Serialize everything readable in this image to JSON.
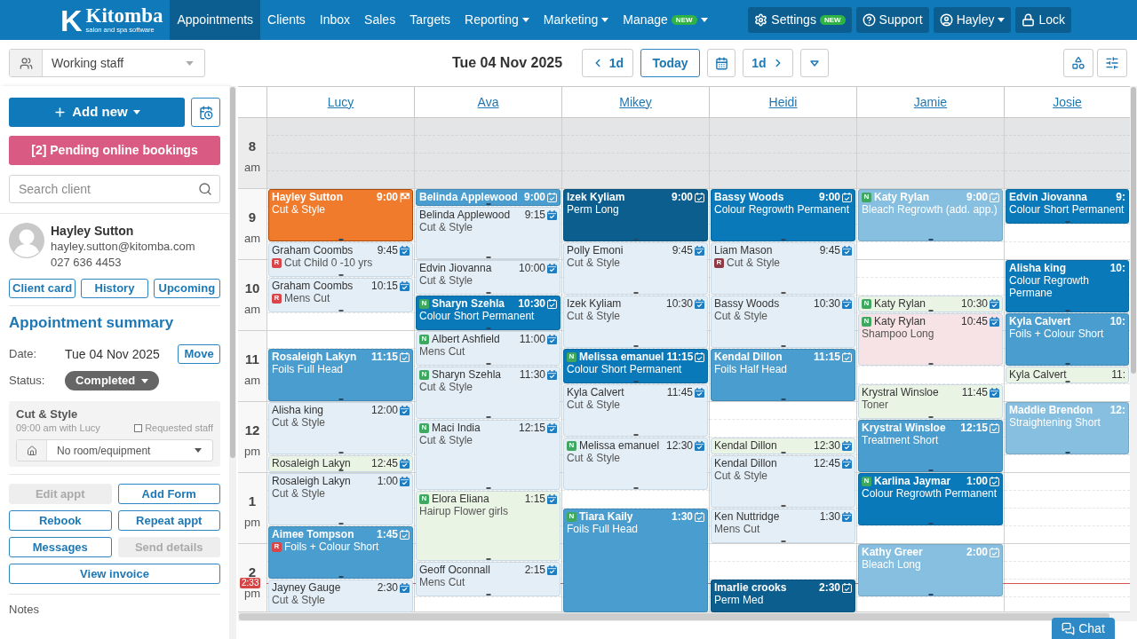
{
  "nav": {
    "logo": {
      "mark": "K",
      "name": "Kitomba",
      "tagline": "salon and spa software"
    },
    "items": [
      {
        "label": "Appointments",
        "selected": true,
        "dropdown": false
      },
      {
        "label": "Clients",
        "selected": false,
        "dropdown": false
      },
      {
        "label": "Inbox",
        "selected": false,
        "dropdown": false
      },
      {
        "label": "Sales",
        "selected": false,
        "dropdown": false
      },
      {
        "label": "Targets",
        "selected": false,
        "dropdown": false
      },
      {
        "label": "Reporting",
        "selected": false,
        "dropdown": true
      },
      {
        "label": "Marketing",
        "selected": false,
        "dropdown": true
      },
      {
        "label": "Manage",
        "selected": false,
        "dropdown": true,
        "badge": "NEW"
      }
    ],
    "actions": [
      {
        "kind": "settings",
        "label": "Settings",
        "badge": "NEW",
        "dropdown": false
      },
      {
        "kind": "support",
        "label": "Support",
        "dropdown": false
      },
      {
        "kind": "user",
        "label": "Hayley",
        "dropdown": true
      },
      {
        "kind": "lock",
        "label": "Lock",
        "dropdown": false
      }
    ]
  },
  "toolbar": {
    "staff_filter": "Working staff",
    "date": "Tue 04 Nov 2025",
    "prev_day": "1d",
    "today": "Today",
    "next_day": "1d"
  },
  "sidebar": {
    "add_new": "Add new",
    "pending": "[2] Pending online bookings",
    "search": {
      "placeholder": "Search client"
    },
    "client": {
      "name": "Hayley Sutton",
      "email": "hayley.sutton@kitomba.com",
      "phone": "027 636 4453"
    },
    "client_buttons": [
      {
        "label": "Client card"
      },
      {
        "label": "History"
      },
      {
        "label": "Upcoming"
      }
    ],
    "summary": {
      "title": "Appointment summary",
      "date_label": "Date:",
      "date": "Tue 04 Nov 2025",
      "move": "Move",
      "status_label": "Status:",
      "status": "Completed"
    },
    "service": {
      "name": "Cut & Style",
      "detail": "09:00 am with Lucy",
      "requested_staff": {
        "label": "Requested staff",
        "checked": false
      },
      "room": {
        "value": "No room/equipment"
      }
    },
    "actions": [
      {
        "label": "Edit appt",
        "disabled": true,
        "wide": false
      },
      {
        "label": "Add Form",
        "disabled": false,
        "wide": false
      },
      {
        "label": "Rebook",
        "disabled": false,
        "wide": false
      },
      {
        "label": "Repeat appt",
        "disabled": false,
        "wide": false
      },
      {
        "label": "Messages",
        "disabled": false,
        "wide": false
      },
      {
        "label": "Send details",
        "disabled": true,
        "wide": false
      },
      {
        "label": "View invoice",
        "disabled": false,
        "wide": true
      }
    ],
    "notes_title": "Notes"
  },
  "calendar": {
    "hours": [
      {
        "hour": "8",
        "period": "am",
        "closed": true
      },
      {
        "hour": "9",
        "period": "am",
        "closed": false
      },
      {
        "hour": "10",
        "period": "am",
        "closed": false
      },
      {
        "hour": "11",
        "period": "am",
        "closed": false
      },
      {
        "hour": "12",
        "period": "pm",
        "closed": false
      },
      {
        "hour": "1",
        "period": "pm",
        "closed": false
      },
      {
        "hour": "2",
        "period": "pm",
        "closed": false,
        "now": "2:33"
      }
    ],
    "staff": [
      {
        "name": "Lucy",
        "entries": [
          {
            "kind": "threequarter",
            "client": "Hayley Sutton",
            "time": "9:00",
            "service": "Cut & Style",
            "color": "#f07b2c",
            "selected": true,
            "completed": true
          },
          {
            "kind": "half",
            "client": "Graham Coombs",
            "time": "9:45",
            "service": "Cut Child 0 -10 yrs",
            "service_tag": {
              "label": "R",
              "color": "#d9464a"
            },
            "color": "#e3eef7",
            "selected": false,
            "completed": false
          },
          {
            "kind": "half",
            "client": "Graham Coombs",
            "time": "10:15",
            "service": "Mens Cut",
            "service_tag": {
              "label": "R",
              "color": "#d9464a"
            },
            "color": "#e3eef7",
            "selected": false,
            "completed": false
          },
          {
            "kind": "gaphalf"
          },
          {
            "kind": "threequarter",
            "client": "Rosaleigh Lakyn",
            "time": "11:15",
            "service": "Foils Full Head",
            "color": "#4a9dcf",
            "selected": false,
            "completed": false
          },
          {
            "kind": "threequarter",
            "client": "Alisha king",
            "time": "12:00",
            "service": "Cut & Style",
            "color": "#e3eef7",
            "selected": false,
            "completed": false
          },
          {
            "kind": "quarter",
            "client": "Rosaleigh Lakyn",
            "time": "12:45",
            "color": "#eaf4e5",
            "selected": false,
            "completed": false
          },
          {
            "kind": "threequarter",
            "client": "Rosaleigh Lakyn",
            "time": "1:00",
            "service": "Cut & Style",
            "color": "#e3eef7",
            "selected": false,
            "completed": false
          },
          {
            "kind": "threequarter",
            "client": "Aimee Tompson",
            "time": "1:45",
            "service": "Foils + Colour Short",
            "service_tag": {
              "label": "R",
              "color": "#d9464a"
            },
            "color": "#4a9dcf",
            "selected": false,
            "completed": false
          },
          {
            "kind": "threequarter",
            "client": "Jayney Gauge",
            "time": "2:30",
            "service": "Cut & Style",
            "color": "#e3eef7",
            "selected": false,
            "completed": false
          }
        ]
      },
      {
        "name": "Ava",
        "entries": [
          {
            "kind": "quarter",
            "client": "Belinda Applewood",
            "time": "9:00",
            "color": "#4a9dcf",
            "selected": false,
            "completed": false
          },
          {
            "kind": "threequarter",
            "client": "Belinda Applewood",
            "time": "9:15",
            "service": "Cut & Style",
            "color": "#e3eef7",
            "selected": false,
            "completed": false
          },
          {
            "kind": "half",
            "client": "Edvin Jiovanna",
            "time": "10:00",
            "service": "Cut & Style",
            "color": "#e3eef7",
            "selected": false,
            "completed": false
          },
          {
            "kind": "half",
            "client": "Sharyn Szehla",
            "time": "10:30",
            "service": "Colour Short Permanent",
            "name_tag": {
              "label": "N",
              "color": "#3ea860"
            },
            "color": "#0a79b9",
            "selected": false,
            "completed": false
          },
          {
            "kind": "half",
            "client": "Albert Ashfield",
            "time": "11:00",
            "service": "Mens Cut",
            "name_tag": {
              "label": "N",
              "color": "#3ea860"
            },
            "color": "#e3eef7",
            "selected": false,
            "completed": false
          },
          {
            "kind": "threequarter",
            "client": "Sharyn Szehla",
            "time": "11:30",
            "service": "Cut & Style",
            "name_tag": {
              "label": "N",
              "color": "#3ea860"
            },
            "color": "#e3eef7",
            "selected": false,
            "completed": false
          },
          {
            "kind": "hour",
            "client": "Maci India",
            "time": "12:15",
            "service": "Cut & Style",
            "name_tag": {
              "label": "N",
              "color": "#3ea860"
            },
            "color": "#e3eef7",
            "selected": false,
            "completed": false
          },
          {
            "kind": "hour",
            "client": "Elora Eliana",
            "time": "1:15",
            "service": "Hairup Flower girls",
            "name_tag": {
              "label": "N",
              "color": "#3ea860"
            },
            "color": "#eaf4e5",
            "selected": false,
            "completed": false
          },
          {
            "kind": "half",
            "client": "Geoff Oconnall",
            "time": "2:15",
            "service": "Mens Cut",
            "color": "#e3eef7",
            "selected": false,
            "completed": false
          }
        ]
      },
      {
        "name": "Mikey",
        "entries": [
          {
            "kind": "threequarter",
            "client": "Izek Kyliam",
            "time": "9:00",
            "service": "Perm Long",
            "color": "#0b5e8e",
            "selected": false,
            "completed": false
          },
          {
            "kind": "threequarter",
            "client": "Polly Emoni",
            "time": "9:45",
            "service": "Cut & Style",
            "color": "#e3eef7",
            "selected": false,
            "completed": false
          },
          {
            "kind": "threequarter",
            "client": "Izek Kyliam",
            "time": "10:30",
            "service": "Cut & Style",
            "color": "#e3eef7",
            "selected": false,
            "completed": false
          },
          {
            "kind": "half",
            "client": "Melissa emanuel",
            "time": "11:15",
            "service": "Colour Short Permanent",
            "name_tag": {
              "label": "N",
              "color": "#3ea860"
            },
            "color": "#0a79b9",
            "selected": false,
            "completed": false
          },
          {
            "kind": "threequarter",
            "client": "Kyla Calvert",
            "time": "11:45",
            "service": "Cut & Style",
            "color": "#e3eef7",
            "selected": false,
            "completed": false
          },
          {
            "kind": "threequarter",
            "client": "Melissa emanuel",
            "time": "12:30",
            "service": "Cut & Style",
            "name_tag": {
              "label": "N",
              "color": "#3ea860"
            },
            "color": "#e3eef7",
            "selected": false,
            "completed": false
          },
          {
            "kind": "gapquarter"
          },
          {
            "kind": "hourhalf",
            "client": "Tiara Kaily",
            "time": "1:30",
            "service": "Foils Full Head",
            "name_tag": {
              "label": "N",
              "color": "#3ea860"
            },
            "color": "#4a9dcf",
            "selected": false,
            "completed": false
          }
        ]
      },
      {
        "name": "Heidi",
        "entries": [
          {
            "kind": "threequarter",
            "client": "Bassy Woods",
            "time": "9:00",
            "service": "Colour Regrowth Permanent",
            "color": "#0a79b9",
            "selected": false,
            "completed": false
          },
          {
            "kind": "threequarter",
            "client": "Liam Mason",
            "time": "9:45",
            "service": "Cut & Style",
            "service_tag": {
              "label": "R",
              "color": "#8e3b46"
            },
            "color": "#e3eef7",
            "selected": false,
            "completed": false
          },
          {
            "kind": "threequarter",
            "client": "Bassy Woods",
            "time": "10:30",
            "service": "Cut & Style",
            "color": "#e3eef7",
            "selected": false,
            "completed": false
          },
          {
            "kind": "threequarter",
            "client": "Kendal Dillon",
            "time": "11:15",
            "service": "Foils Half Head",
            "color": "#4a9dcf",
            "selected": false,
            "completed": false
          },
          {
            "kind": "gaphalf"
          },
          {
            "kind": "quarter",
            "client": "Kendal Dillon",
            "time": "12:30",
            "color": "#eaf4e5",
            "selected": false,
            "completed": false
          },
          {
            "kind": "threequarter",
            "client": "Kendal Dillon",
            "time": "12:45",
            "service": "Cut & Style",
            "color": "#e3eef7",
            "selected": false,
            "completed": false
          },
          {
            "kind": "half",
            "client": "Ken Nuttridge",
            "time": "1:30",
            "service": "Mens Cut",
            "color": "#e3eef7",
            "selected": false,
            "completed": false
          },
          {
            "kind": "gaphalf"
          },
          {
            "kind": "threequarter",
            "client": "Imarlie crooks",
            "time": "2:30",
            "service": "Perm Med",
            "color": "#0b5e8e",
            "selected": false,
            "completed": false
          }
        ]
      },
      {
        "name": "Jamie",
        "entries": [
          {
            "kind": "threequarter",
            "client": "Katy Rylan",
            "time": "9:00",
            "service": "Bleach Regrowth (add. app.)",
            "name_tag": {
              "label": "N",
              "color": "#3ea860"
            },
            "color": "#87bfe0",
            "selected": false,
            "completed": false
          },
          {
            "kind": "gapthreequarter"
          },
          {
            "kind": "quarter",
            "client": "Katy Rylan",
            "time": "10:30",
            "name_tag": {
              "label": "N",
              "color": "#3ea860"
            },
            "color": "#eaf4e5",
            "selected": false,
            "completed": false
          },
          {
            "kind": "threequarter",
            "client": "Katy Rylan",
            "time": "10:45",
            "service": "Shampoo Long",
            "name_tag": {
              "label": "N",
              "color": "#3ea860"
            },
            "color": "#f7e3e6",
            "selected": false,
            "completed": false
          },
          {
            "kind": "gapquarter"
          },
          {
            "kind": "half",
            "client": "Krystral Winsloe",
            "time": "11:45",
            "service": "Toner",
            "color": "#eaf4e5",
            "selected": false,
            "completed": false
          },
          {
            "kind": "threequarter",
            "client": "Krystral Winsloe",
            "time": "12:15",
            "service": "Treatment Short",
            "color": "#4a9dcf",
            "selected": false,
            "completed": false
          },
          {
            "kind": "threequarter",
            "client": "Karlina Jaymar",
            "time": "1:00",
            "service": "Colour Regrowth Permanent",
            "name_tag": {
              "label": "N",
              "color": "#3ea860"
            },
            "color": "#0a79b9",
            "selected": false,
            "completed": false
          },
          {
            "kind": "gapquarter"
          },
          {
            "kind": "threequarter",
            "client": "Kathy Greer",
            "time": "2:00",
            "service": "Bleach Long",
            "color": "#87bfe0",
            "selected": false,
            "completed": false
          }
        ]
      },
      {
        "name": "Josie",
        "entries": [
          {
            "kind": "half",
            "client": "Edvin Jiovanna",
            "time": "9:",
            "service": "Colour Short Permanent",
            "color": "#0a79b9",
            "selected": false
          },
          {
            "kind": "gaphalf"
          },
          {
            "kind": "threequarter",
            "client": "Alisha king",
            "time": "10:",
            "service": "Colour Regrowth Permane",
            "color": "#0a79b9",
            "selected": false
          },
          {
            "kind": "threequarter",
            "client": "Kyla Calvert",
            "time": "10:",
            "service": "Foils + Colour Short",
            "color": "#4a9dcf",
            "selected": false
          },
          {
            "kind": "quarter",
            "client": "Kyla Calvert",
            "time": "11:",
            "color": "#eaf4e5",
            "selected": false
          },
          {
            "kind": "gapquarter"
          },
          {
            "kind": "threequarter",
            "client": "Maddie Brendon",
            "time": "12:",
            "service": "Straightening Short",
            "color": "#87bfe0",
            "selected": false
          }
        ]
      }
    ]
  },
  "chat": "Chat"
}
